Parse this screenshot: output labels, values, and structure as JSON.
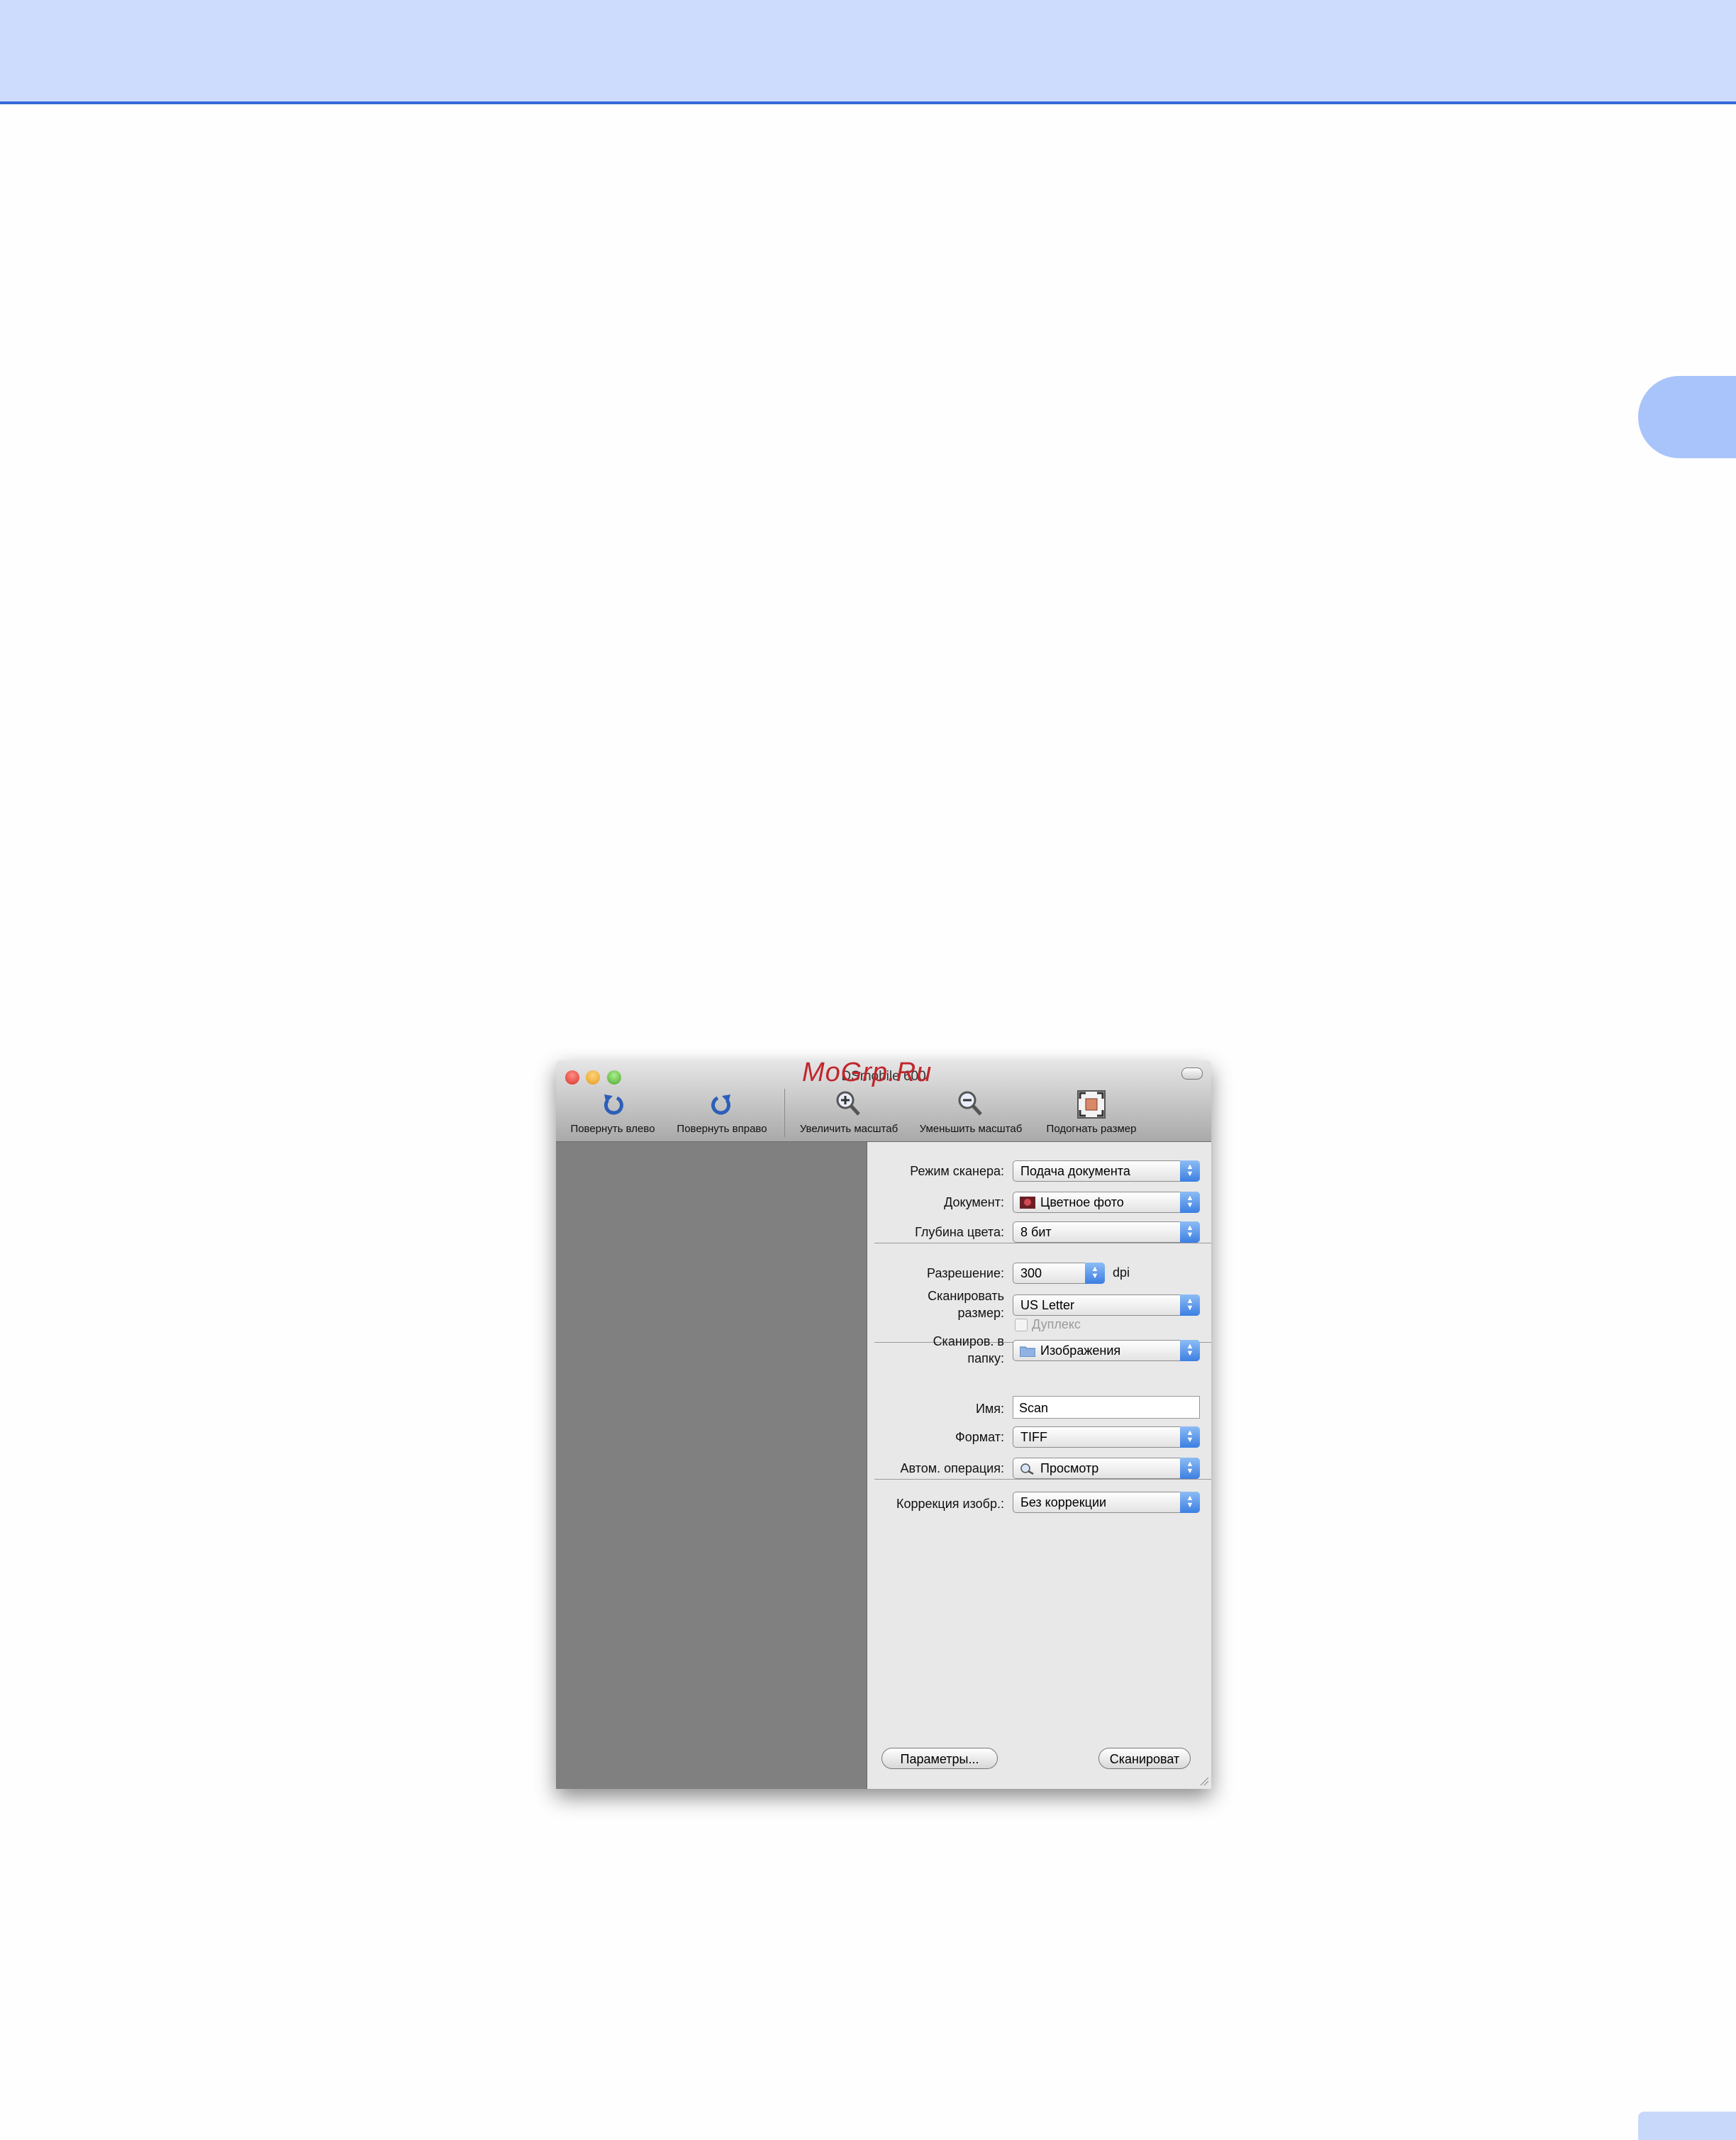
{
  "window": {
    "title": "DSmobile 600",
    "watermark": "MoGrp.Ru"
  },
  "toolbar": {
    "rotate_left": "Повернуть влево",
    "rotate_right": "Повернуть вправо",
    "zoom_in": "Увеличить масштаб",
    "zoom_out": "Уменьшить масштаб",
    "fit": "Подогнать размер"
  },
  "settings": {
    "scanner_mode": {
      "label": "Режим сканера:",
      "value": "Подача документа"
    },
    "document": {
      "label": "Документ:",
      "value": "Цветное фото"
    },
    "color_depth": {
      "label": "Глубина цвета:",
      "value": "8 бит"
    },
    "resolution": {
      "label": "Разрешение:",
      "value": "300",
      "unit": "dpi"
    },
    "scan_size": {
      "label_line1": "Сканировать",
      "label_line2": "размер:",
      "value": "US Letter"
    },
    "duplex": {
      "label": "Дуплекс",
      "checked": false
    },
    "scan_to_folder": {
      "label_line1": "Сканиров. в",
      "label_line2": "папку:",
      "value": "Изображения"
    },
    "name": {
      "label": "Имя:",
      "value": "Scan"
    },
    "format": {
      "label": "Формат:",
      "value": "TIFF"
    },
    "auto_operation": {
      "label": "Автом. операция:",
      "value": "Просмотр"
    },
    "image_correction": {
      "label": "Коррекция изобр.:",
      "value": "Без коррекции"
    }
  },
  "buttons": {
    "parameters": "Параметры...",
    "scan": "Сканироват"
  },
  "colors": {
    "header_band": "#cddcfc",
    "header_line": "#3568d8",
    "side_tab": "#a9c3fb",
    "popup_arrow": "#3c7fe2"
  }
}
